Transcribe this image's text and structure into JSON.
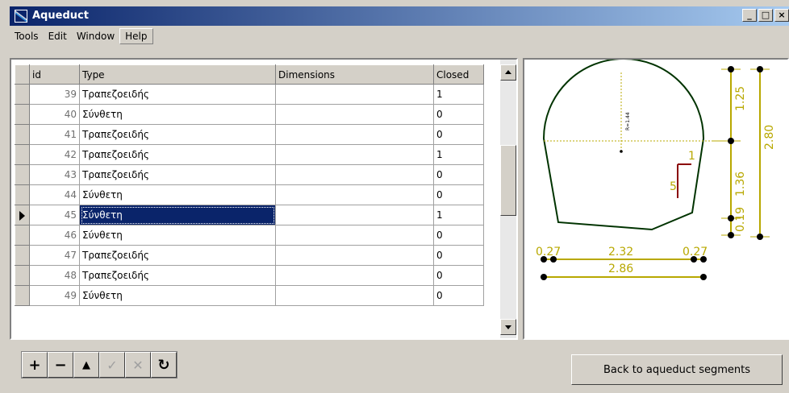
{
  "window": {
    "title": "Aqueduct",
    "controls": [
      "_",
      "□",
      "×"
    ]
  },
  "menu": [
    "Tools",
    "Edit",
    "Window",
    "Help"
  ],
  "grid": {
    "headers": {
      "id": "id",
      "type": "Type",
      "dimensions": "Dimensions",
      "closed": "Closed"
    },
    "rows": [
      {
        "id": "39",
        "type": "Τραπεζοειδής",
        "dimensions": "",
        "closed": "1"
      },
      {
        "id": "40",
        "type": "Σύνθετη",
        "dimensions": "",
        "closed": "0"
      },
      {
        "id": "41",
        "type": "Τραπεζοειδής",
        "dimensions": "",
        "closed": "0"
      },
      {
        "id": "42",
        "type": "Τραπεζοειδής",
        "dimensions": "",
        "closed": "1"
      },
      {
        "id": "43",
        "type": "Τραπεζοειδής",
        "dimensions": "",
        "closed": "0"
      },
      {
        "id": "44",
        "type": "Σύνθετη",
        "dimensions": "",
        "closed": "0"
      },
      {
        "id": "45",
        "type": "Σύνθετη",
        "dimensions": "",
        "closed": "1"
      },
      {
        "id": "46",
        "type": "Σύνθετη",
        "dimensions": "",
        "closed": "0"
      },
      {
        "id": "47",
        "type": "Τραπεζοειδής",
        "dimensions": "",
        "closed": "0"
      },
      {
        "id": "48",
        "type": "Τραπεζοειδής",
        "dimensions": "",
        "closed": "0"
      },
      {
        "id": "49",
        "type": "Σύνθετη",
        "dimensions": "",
        "closed": "0"
      }
    ],
    "selected_id": "45"
  },
  "drawing": {
    "radius_label": "R=1.44",
    "heights": [
      "1.25",
      "1.36",
      "0.19"
    ],
    "total_height": "2.80",
    "widths": [
      "0.27",
      "2.32",
      "0.27"
    ],
    "total_width": "2.86",
    "slope": [
      "1",
      "5"
    ],
    "colors": {
      "outline": "#003300",
      "dimension": "#b8a800",
      "slope": "#8b0000"
    }
  },
  "toolbar": {
    "buttons": [
      {
        "name": "add",
        "glyph": "+",
        "enabled": true
      },
      {
        "name": "remove",
        "glyph": "−",
        "enabled": true
      },
      {
        "name": "move-up",
        "glyph": "▲",
        "enabled": true
      },
      {
        "name": "confirm",
        "glyph": "✓",
        "enabled": false
      },
      {
        "name": "cancel",
        "glyph": "✕",
        "enabled": false
      },
      {
        "name": "refresh",
        "glyph": "↻",
        "enabled": true
      }
    ],
    "back_label": "Back to aqueduct segments"
  }
}
